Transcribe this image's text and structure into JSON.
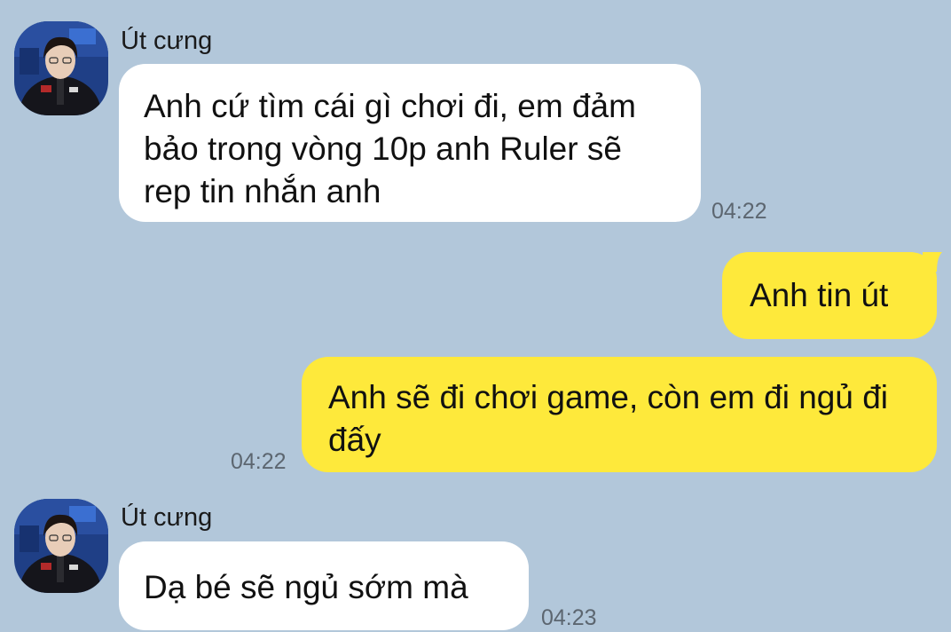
{
  "colors": {
    "background": "#b2c7da",
    "incoming_bubble": "#ffffff",
    "outgoing_bubble": "#fee93b",
    "time_text": "#5c6670"
  },
  "messages": [
    {
      "sender": "Út cưng",
      "avatar_icon": "profile-photo-icon",
      "text": "Anh cứ tìm cái gì chơi đi, em đảm bảo trong vòng 10p anh Ruler sẽ rep tin nhắn anh",
      "time": "04:22"
    },
    {
      "text": "Anh tin út"
    },
    {
      "text": "Anh sẽ đi chơi game, còn em đi ngủ đi đấy",
      "time": "04:22"
    },
    {
      "sender": "Út cưng",
      "avatar_icon": "profile-photo-icon",
      "text": "Dạ bé sẽ ngủ sớm mà",
      "time": "04:23"
    }
  ]
}
